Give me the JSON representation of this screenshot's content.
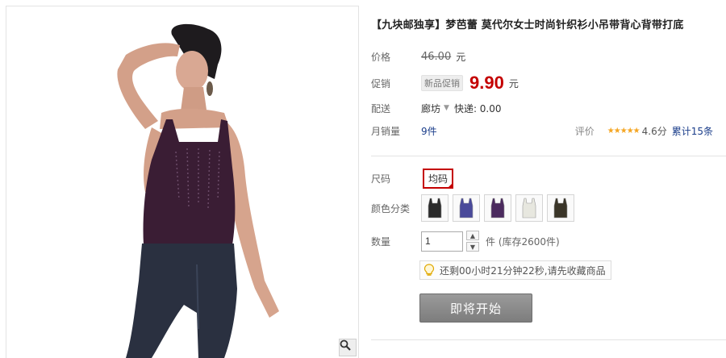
{
  "gallery": {
    "zoom_icon": "magnifier-icon"
  },
  "product": {
    "title": "【九块邮独享】梦芭蕾 莫代尔女士时尚针织衫小吊带背心背带打底"
  },
  "price": {
    "label": "价格",
    "original": "46.00",
    "unit": "元"
  },
  "promo": {
    "label": "促销",
    "tag": "新品促销",
    "price": "9.90",
    "unit": "元"
  },
  "shipping": {
    "label": "配送",
    "location": "廊坊",
    "method": "快递: 0.00"
  },
  "sales": {
    "label": "月销量",
    "count": "9件",
    "rating_label": "评价",
    "stars": "★★★★★",
    "score": "4.6分",
    "reviews": "累计15条"
  },
  "size": {
    "label": "尺码",
    "selected": "均码"
  },
  "color": {
    "label": "颜色分类",
    "swatches": [
      "#2b2b2b",
      "#4a4a9a",
      "#4b2a5e",
      "#e7e7df",
      "#3a3528"
    ]
  },
  "quantity": {
    "label": "数量",
    "value": "1",
    "stock": "件 (库存2600件)",
    "up_icon": "arrow-up-icon",
    "down_icon": "arrow-down-icon"
  },
  "notice": {
    "icon": "lightbulb-icon",
    "text": "还剩00小时21分钟22秒,请先收藏商品"
  },
  "buy_button": {
    "label": "即将开始"
  }
}
